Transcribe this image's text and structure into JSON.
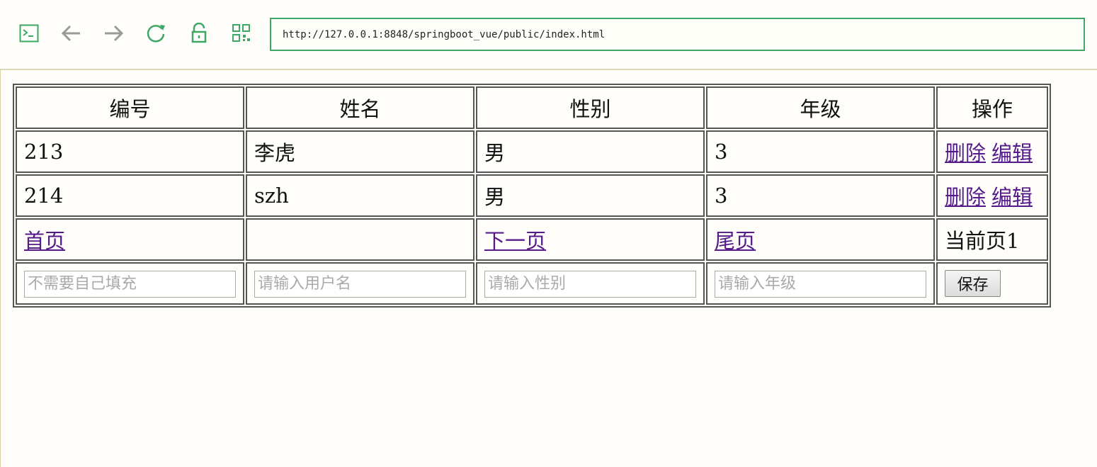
{
  "browser": {
    "url": "http://127.0.0.1:8848/springboot_vue/public/index.html",
    "icons": [
      "terminal-icon",
      "back-arrow-icon",
      "forward-arrow-icon",
      "reload-icon",
      "unlock-icon",
      "qrcode-icon"
    ],
    "accent_color": "#3fa866"
  },
  "table": {
    "headers": [
      "编号",
      "姓名",
      "性别",
      "年级",
      "操作"
    ],
    "rows": [
      {
        "id": "213",
        "name": "李虎",
        "gender": "男",
        "grade": "3",
        "delete": "删除",
        "edit": "编辑"
      },
      {
        "id": "214",
        "name": "szh",
        "gender": "男",
        "grade": "3",
        "delete": "删除",
        "edit": "编辑"
      }
    ],
    "pagination": {
      "first": "首页",
      "next": "下一页",
      "last": "尾页",
      "current": "当前页1"
    },
    "form": {
      "id_placeholder": "不需要自己填充",
      "name_placeholder": "请输入用户名",
      "gender_placeholder": "请输入性别",
      "grade_placeholder": "请输入年级",
      "save_label": "保存"
    },
    "link_color": "#551a8b"
  }
}
